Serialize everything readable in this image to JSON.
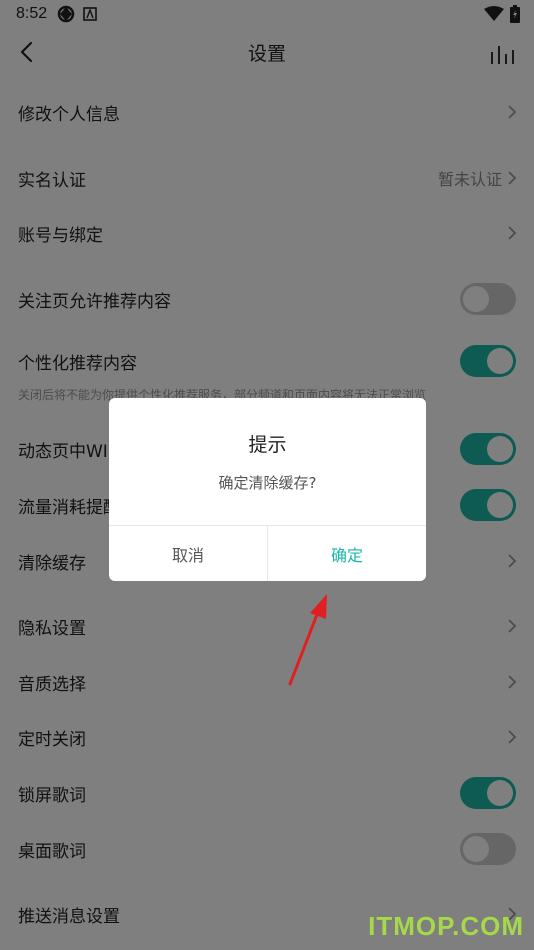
{
  "status_bar": {
    "time": "8:52"
  },
  "header": {
    "title": "设置"
  },
  "rows": [
    {
      "label": "修改个人信息",
      "value": "",
      "control": "chevron"
    },
    {
      "label": "实名认证",
      "value": "暂未认证",
      "control": "chevron"
    },
    {
      "label": "账号与绑定",
      "value": "",
      "control": "chevron"
    },
    {
      "label": "关注页允许推荐内容",
      "value": "",
      "control": "toggle",
      "on": false
    },
    {
      "label": "个性化推荐内容",
      "value": "",
      "control": "toggle",
      "on": true
    },
    {
      "label": "动态页中WI",
      "value": "",
      "control": "toggle",
      "on": true
    },
    {
      "label": "流量消耗提醒",
      "value": "",
      "control": "toggle",
      "on": true
    },
    {
      "label": "清除缓存",
      "value": "",
      "control": "chevron"
    },
    {
      "label": "隐私设置",
      "value": "",
      "control": "chevron"
    },
    {
      "label": "音质选择",
      "value": "",
      "control": "chevron"
    },
    {
      "label": "定时关闭",
      "value": "",
      "control": "chevron"
    },
    {
      "label": "锁屏歌词",
      "value": "",
      "control": "toggle",
      "on": true
    },
    {
      "label": "桌面歌词",
      "value": "",
      "control": "toggle",
      "on": false
    },
    {
      "label": "推送消息设置",
      "value": "",
      "control": "chevron"
    }
  ],
  "hint": "关闭后将不能为你提供个性化推荐服务，部分频道和页面内容将无法正常浏览",
  "dialog": {
    "title": "提示",
    "message": "确定清除缓存?",
    "cancel_label": "取消",
    "confirm_label": "确定"
  },
  "watermark": "ITMOP.COM",
  "colors": {
    "accent": "#1bb6a6",
    "arrow": "#e02020",
    "watermark": "#a5d94a"
  }
}
